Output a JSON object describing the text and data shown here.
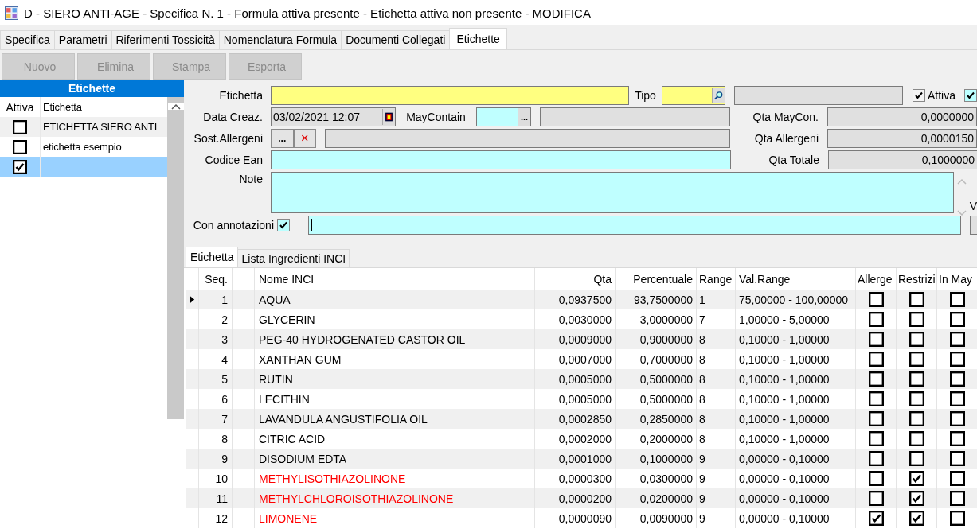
{
  "window": {
    "title": "D - SIERO ANTI-AGE - Specifica N. 1 - Formula attiva presente - Etichetta attiva non presente - MODIFICA"
  },
  "tabs": [
    {
      "label": "Specifica",
      "selected": false
    },
    {
      "label": "Parametri",
      "selected": false
    },
    {
      "label": "Riferimenti Tossicità",
      "selected": false
    },
    {
      "label": "Nomenclatura Formula",
      "selected": false
    },
    {
      "label": "Documenti Collegati",
      "selected": false
    },
    {
      "label": "Etichette",
      "selected": true
    }
  ],
  "toolbar": [
    {
      "label": "Nuovo",
      "disabled": true
    },
    {
      "label": "Elimina",
      "disabled": true
    },
    {
      "label": "Stampa",
      "disabled": true
    },
    {
      "label": "Esporta",
      "disabled": true
    }
  ],
  "labels_list": {
    "title": "Etichette",
    "columns": [
      "Attiva",
      "Etichetta"
    ],
    "rows": [
      {
        "active": false,
        "name": "ETICHETTA SIERO ANTI",
        "selected": false
      },
      {
        "active": false,
        "name": "etichetta esempio",
        "selected": false
      },
      {
        "active": true,
        "name": "",
        "selected": true
      }
    ]
  },
  "form": {
    "etichetta_label": "Etichetta",
    "tipo_label": "Tipo",
    "attiva_label": "Attiva",
    "attiva": true,
    "extra_checkbox": true,
    "data_creaz_label": "Data Creaz.",
    "data_creaz": "03/02/2021 12:07",
    "maycontain_label": "MayContain",
    "maycontain_button": "...",
    "qta_maycon_label": "Qta MayCon.",
    "qta_maycon": "0,0000000",
    "sost_allergeni_label": "Sost.Allergeni",
    "sost_pick_button": "...",
    "sost_clear_button": "×",
    "qta_allergeni_label": "Qta Allergeni",
    "qta_allergeni": "0,0000150",
    "codice_ean_label": "Codice Ean",
    "qta_totale_label": "Qta Totale",
    "qta_totale": "0,1000000",
    "note_label": "Note",
    "note_side_label": "V",
    "con_annotazioni_label": "Con annotazioni",
    "con_annotazioni": true
  },
  "sub_tabs": [
    {
      "label": "Etichetta",
      "selected": true
    },
    {
      "label": "Lista Ingredienti INCI",
      "selected": false
    }
  ],
  "table": {
    "columns": [
      "Seq.",
      "Nome INCI",
      "Qta",
      "Percentuale",
      "Range",
      "Val.Range",
      "Allerge",
      "Restrizi",
      "In May"
    ],
    "rows": [
      {
        "seq": "1",
        "name": "AQUA",
        "qta": "0,0937500",
        "perc": "93,7500000",
        "range": "1",
        "val_range": "75,00000 - 100,00000",
        "allergen": false,
        "restricted": false,
        "in_may": false,
        "current": true,
        "color": "#000000"
      },
      {
        "seq": "2",
        "name": "GLYCERIN",
        "qta": "0,0030000",
        "perc": "3,0000000",
        "range": "7",
        "val_range": "1,00000 - 5,00000",
        "allergen": false,
        "restricted": false,
        "in_may": false,
        "current": false,
        "color": "#000000"
      },
      {
        "seq": "3",
        "name": "PEG-40 HYDROGENATED  CASTOR OIL",
        "qta": "0,0009000",
        "perc": "0,9000000",
        "range": "8",
        "val_range": "0,10000 - 1,00000",
        "allergen": false,
        "restricted": false,
        "in_may": false,
        "current": false,
        "color": "#000000"
      },
      {
        "seq": "4",
        "name": "XANTHAN GUM",
        "qta": "0,0007000",
        "perc": "0,7000000",
        "range": "8",
        "val_range": "0,10000 - 1,00000",
        "allergen": false,
        "restricted": false,
        "in_may": false,
        "current": false,
        "color": "#000000"
      },
      {
        "seq": "5",
        "name": "RUTIN",
        "qta": "0,0005000",
        "perc": "0,5000000",
        "range": "8",
        "val_range": "0,10000 - 1,00000",
        "allergen": false,
        "restricted": false,
        "in_may": false,
        "current": false,
        "color": "#000000"
      },
      {
        "seq": "6",
        "name": "LECITHIN",
        "qta": "0,0005000",
        "perc": "0,5000000",
        "range": "8",
        "val_range": "0,10000 - 1,00000",
        "allergen": false,
        "restricted": false,
        "in_may": false,
        "current": false,
        "color": "#000000"
      },
      {
        "seq": "7",
        "name": "LAVANDULA ANGUSTIFOLIA OIL",
        "qta": "0,0002850",
        "perc": "0,2850000",
        "range": "8",
        "val_range": "0,10000 - 1,00000",
        "allergen": false,
        "restricted": false,
        "in_may": false,
        "current": false,
        "color": "#000000"
      },
      {
        "seq": "8",
        "name": "CITRIC ACID",
        "qta": "0,0002000",
        "perc": "0,2000000",
        "range": "8",
        "val_range": "0,10000 - 1,00000",
        "allergen": false,
        "restricted": false,
        "in_may": false,
        "current": false,
        "color": "#000000"
      },
      {
        "seq": "9",
        "name": "DISODIUM EDTA",
        "qta": "0,0001000",
        "perc": "0,1000000",
        "range": "9",
        "val_range": "0,00000 - 0,10000",
        "allergen": false,
        "restricted": false,
        "in_may": false,
        "current": false,
        "color": "#000000"
      },
      {
        "seq": "10",
        "name": "METHYLISOTHIAZOLINONE",
        "qta": "0,0000300",
        "perc": "0,0300000",
        "range": "9",
        "val_range": "0,00000 - 0,10000",
        "allergen": false,
        "restricted": true,
        "in_may": false,
        "current": false,
        "color": "#ff0000"
      },
      {
        "seq": "11",
        "name": "METHYLCHLOROISOTHIAZOLINONE",
        "qta": "0,0000200",
        "perc": "0,0200000",
        "range": "9",
        "val_range": "0,00000 - 0,10000",
        "allergen": false,
        "restricted": true,
        "in_may": false,
        "current": false,
        "color": "#ff0000"
      },
      {
        "seq": "12",
        "name": "LIMONENE",
        "qta": "0,0000090",
        "perc": "0,0090000",
        "range": "9",
        "val_range": "0,00000 - 0,10000",
        "allergen": true,
        "restricted": true,
        "in_may": false,
        "current": false,
        "color": "#ff0000"
      }
    ]
  }
}
